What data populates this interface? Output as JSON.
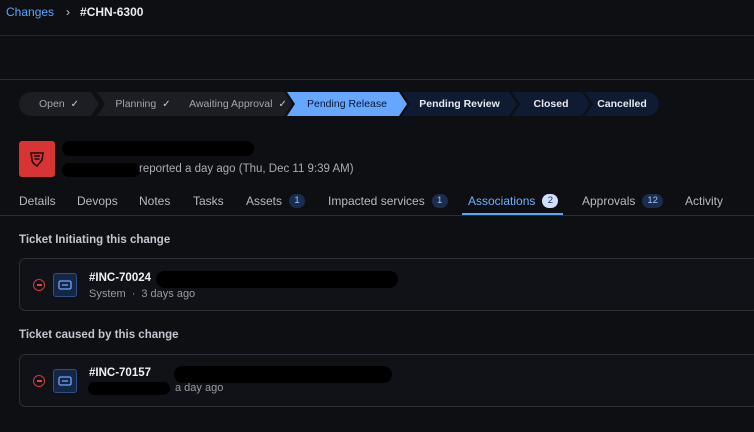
{
  "breadcrumb": {
    "parent": "Changes",
    "separator": "›",
    "current": "#CHN-6300"
  },
  "stages": [
    {
      "label": "Open",
      "state": "done"
    },
    {
      "label": "Planning",
      "state": "done"
    },
    {
      "label": "Awaiting Approval",
      "state": "done"
    },
    {
      "label": "Pending Release",
      "state": "current"
    },
    {
      "label": "Pending Review",
      "state": "todo"
    },
    {
      "label": "Closed",
      "state": "todo"
    },
    {
      "label": "Cancelled",
      "state": "todo"
    }
  ],
  "header": {
    "reported": "reported a day ago (Thu, Dec 11 9:39 AM)"
  },
  "tabs": [
    {
      "label": "Details"
    },
    {
      "label": "Devops"
    },
    {
      "label": "Notes"
    },
    {
      "label": "Tasks"
    },
    {
      "label": "Assets",
      "count": "1"
    },
    {
      "label": "Impacted services",
      "count": "1"
    },
    {
      "label": "Associations",
      "count": "2",
      "active": true
    },
    {
      "label": "Approvals",
      "count": "12"
    },
    {
      "label": "Activity"
    }
  ],
  "sections": [
    {
      "title": "Ticket Initiating this change",
      "ticket": {
        "id": "#INC-70024",
        "source": "System",
        "time": "3 days ago",
        "separator": "·"
      }
    },
    {
      "title": "Ticket caused by this change",
      "ticket": {
        "id": "#INC-70157",
        "time": "a day ago"
      }
    }
  ],
  "colors": {
    "accent": "#5aa3ff",
    "current_stage": "#66a6ff",
    "todo_stage": "#0f1a33",
    "danger": "#d93434"
  },
  "icons": {
    "stage_done": "check-icon",
    "avatar": "shield-icon",
    "ticket": "ticket-icon",
    "remove": "remove-circle-icon"
  }
}
